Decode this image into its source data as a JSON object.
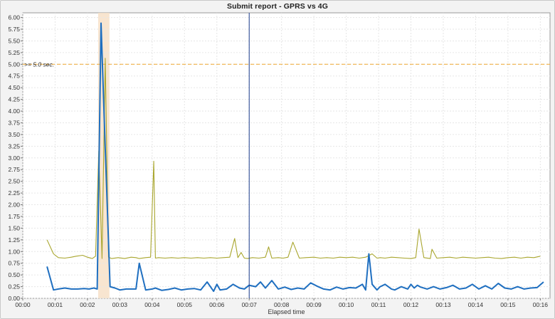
{
  "chart_data": {
    "type": "line",
    "title": "Submit report - GPRS vs 4G",
    "xlabel": "Elapsed time",
    "ylabel": "",
    "xlim": [
      0,
      16.3
    ],
    "ylim": [
      0,
      6.1
    ],
    "x_ticks": [
      "00:00",
      "00:01",
      "00:02",
      "00:03",
      "00:04",
      "00:05",
      "00:06",
      "00:07",
      "00:08",
      "00:09",
      "00:10",
      "00:11",
      "00:12",
      "00:13",
      "00:14",
      "00:15",
      "00:16"
    ],
    "y_ticks": [
      "0.00",
      "0.25",
      "0.50",
      "0.75",
      "1.00",
      "1.25",
      "1.50",
      "1.75",
      "2.00",
      "2.25",
      "2.50",
      "2.75",
      "3.00",
      "3.25",
      "3.50",
      "3.75",
      "4.00",
      "4.25",
      "4.50",
      "4.75",
      "5.00",
      "5.25",
      "5.50",
      "5.75",
      "6.00"
    ],
    "threshold": {
      "value": 5.0,
      "label": ">= 5.0 sec.",
      "color": "#f0a830"
    },
    "highlight_band": {
      "x_start": 2.33,
      "x_end": 2.68,
      "color": "#f7e1c8"
    },
    "cursor_x": 7.0,
    "grid": true,
    "series": [
      {
        "color": "#a9a62e",
        "x": [
          0.75,
          0.95,
          1.1,
          1.3,
          1.5,
          1.65,
          1.85,
          2.0,
          2.15,
          2.25,
          2.35,
          2.45,
          2.55,
          2.65,
          2.75,
          2.95,
          3.15,
          3.35,
          3.5,
          3.6,
          3.8,
          3.95,
          4.05,
          4.1,
          4.2,
          4.4,
          4.6,
          4.8,
          5.0,
          5.2,
          5.4,
          5.6,
          5.8,
          6.0,
          6.2,
          6.4,
          6.55,
          6.65,
          6.75,
          6.85,
          6.95,
          7.1,
          7.3,
          7.5,
          7.6,
          7.7,
          7.9,
          8.05,
          8.2,
          8.35,
          8.55,
          8.75,
          9.0,
          9.2,
          9.4,
          9.6,
          9.8,
          10.0,
          10.2,
          10.4,
          10.6,
          10.8,
          10.95,
          11.05,
          11.2,
          11.4,
          11.6,
          11.8,
          12.0,
          12.15,
          12.25,
          12.4,
          12.6,
          12.65,
          12.8,
          13.0,
          13.2,
          13.4,
          13.6,
          13.8,
          14.0,
          14.2,
          14.4,
          14.6,
          14.8,
          15.0,
          15.2,
          15.4,
          15.6,
          15.8,
          16.0
        ],
        "y": [
          1.25,
          0.95,
          0.87,
          0.86,
          0.88,
          0.9,
          0.92,
          0.88,
          0.85,
          0.9,
          3.15,
          0.85,
          5.13,
          0.88,
          0.85,
          0.87,
          0.85,
          0.88,
          0.87,
          0.85,
          0.87,
          0.88,
          2.93,
          0.86,
          0.87,
          0.86,
          0.87,
          0.86,
          0.87,
          0.86,
          0.87,
          0.86,
          0.87,
          0.86,
          0.87,
          0.88,
          1.28,
          0.87,
          0.98,
          0.86,
          0.85,
          0.87,
          0.86,
          0.88,
          1.1,
          0.86,
          0.87,
          0.86,
          0.88,
          1.2,
          0.86,
          0.87,
          0.88,
          0.86,
          0.87,
          0.86,
          0.88,
          0.87,
          0.88,
          0.86,
          0.88,
          0.95,
          0.86,
          0.87,
          0.86,
          0.88,
          0.87,
          0.86,
          0.85,
          0.87,
          1.48,
          0.87,
          0.85,
          1.05,
          0.86,
          0.87,
          0.88,
          0.86,
          0.88,
          0.87,
          0.86,
          0.87,
          0.88,
          0.86,
          0.85,
          0.87,
          0.88,
          0.86,
          0.88,
          0.87,
          0.9
        ]
      },
      {
        "color": "#1f6fc0",
        "x": [
          0.75,
          0.95,
          1.1,
          1.3,
          1.5,
          1.7,
          1.9,
          2.05,
          2.2,
          2.3,
          2.42,
          2.55,
          2.7,
          2.85,
          3.0,
          3.2,
          3.35,
          3.5,
          3.6,
          3.8,
          4.0,
          4.1,
          4.3,
          4.5,
          4.7,
          4.9,
          5.1,
          5.3,
          5.5,
          5.7,
          5.8,
          5.9,
          6.0,
          6.1,
          6.3,
          6.5,
          6.7,
          6.85,
          7.0,
          7.2,
          7.35,
          7.5,
          7.7,
          7.9,
          8.1,
          8.3,
          8.5,
          8.7,
          8.9,
          9.1,
          9.3,
          9.5,
          9.7,
          9.9,
          10.1,
          10.3,
          10.5,
          10.6,
          10.7,
          10.8,
          10.95,
          11.05,
          11.2,
          11.4,
          11.5,
          11.7,
          11.9,
          12.0,
          12.1,
          12.2,
          12.3,
          12.5,
          12.7,
          12.9,
          13.1,
          13.3,
          13.5,
          13.7,
          13.9,
          14.1,
          14.3,
          14.5,
          14.7,
          14.9,
          15.1,
          15.3,
          15.5,
          15.7,
          15.9,
          16.1
        ],
        "y": [
          0.68,
          0.18,
          0.2,
          0.22,
          0.2,
          0.2,
          0.21,
          0.2,
          0.22,
          0.2,
          5.88,
          3.2,
          0.25,
          0.22,
          0.18,
          0.2,
          0.2,
          0.2,
          0.75,
          0.18,
          0.2,
          0.22,
          0.17,
          0.19,
          0.22,
          0.18,
          0.2,
          0.21,
          0.18,
          0.35,
          0.25,
          0.15,
          0.3,
          0.18,
          0.2,
          0.3,
          0.22,
          0.2,
          0.28,
          0.25,
          0.35,
          0.22,
          0.38,
          0.2,
          0.24,
          0.19,
          0.22,
          0.2,
          0.33,
          0.26,
          0.2,
          0.18,
          0.24,
          0.2,
          0.23,
          0.22,
          0.3,
          0.18,
          0.95,
          0.3,
          0.18,
          0.25,
          0.3,
          0.2,
          0.18,
          0.25,
          0.2,
          0.3,
          0.22,
          0.28,
          0.24,
          0.2,
          0.25,
          0.2,
          0.23,
          0.28,
          0.2,
          0.22,
          0.3,
          0.2,
          0.27,
          0.2,
          0.32,
          0.22,
          0.2,
          0.25,
          0.2,
          0.22,
          0.23,
          0.35
        ]
      }
    ]
  }
}
